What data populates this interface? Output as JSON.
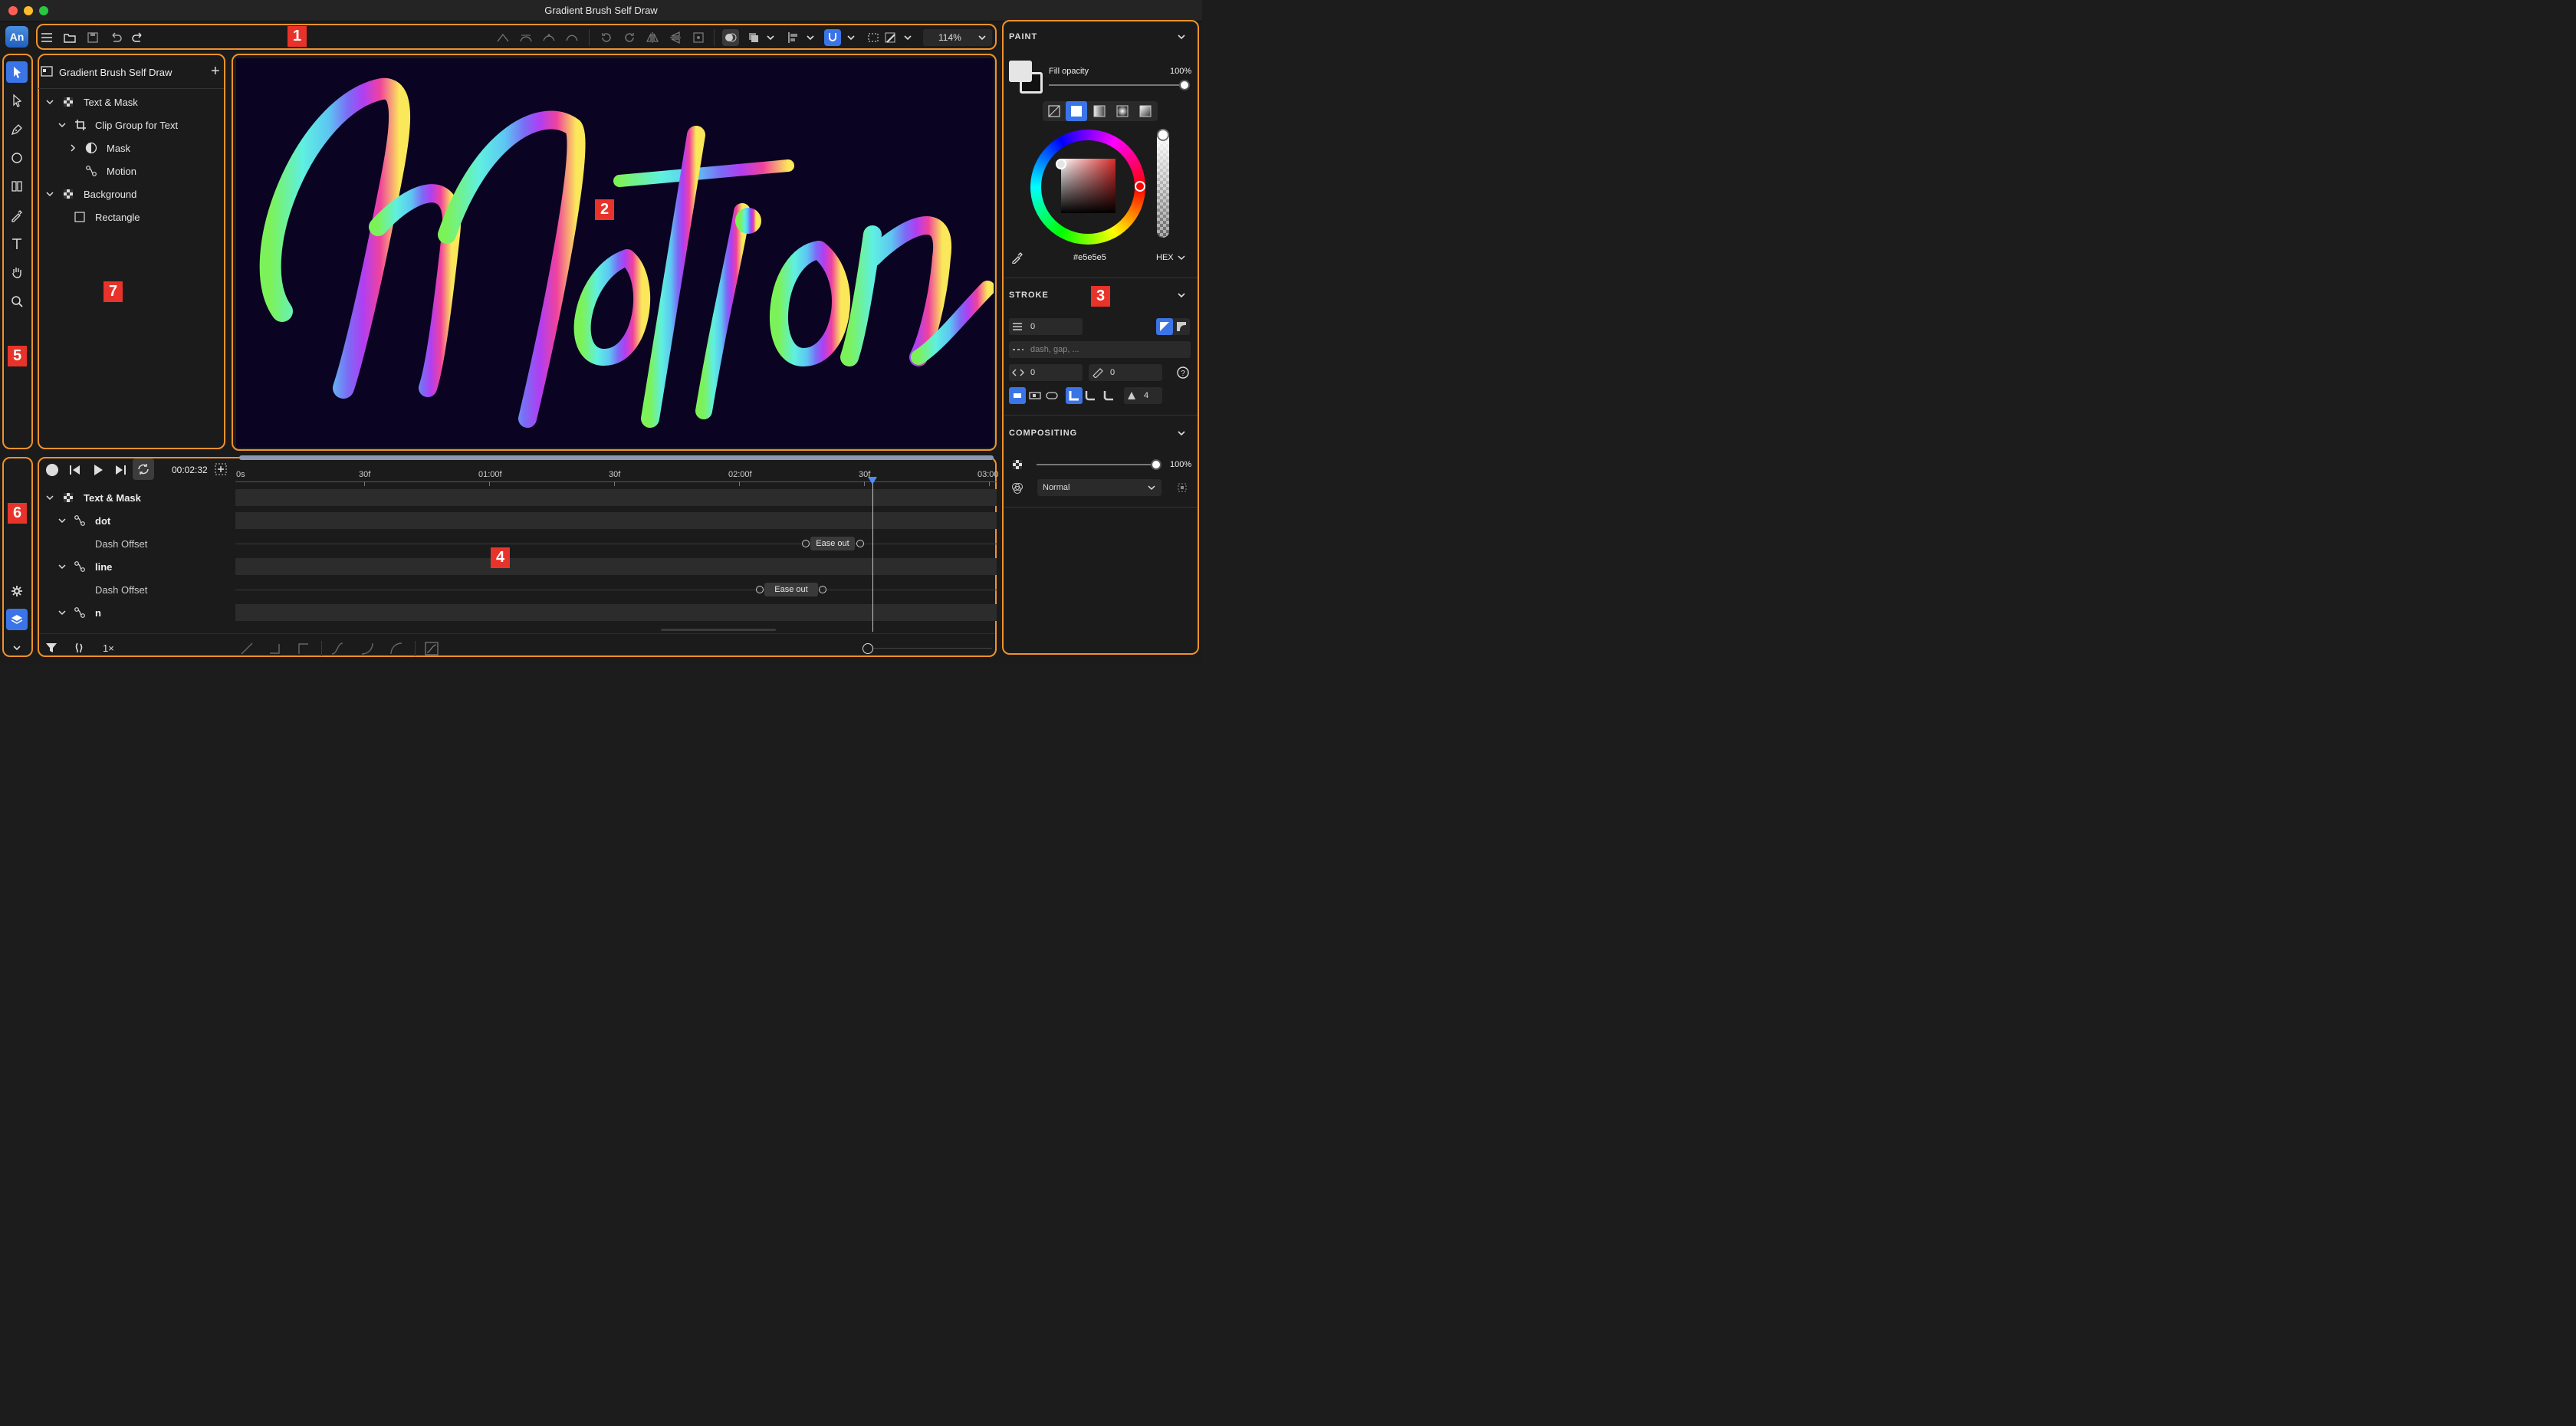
{
  "window": {
    "title": "Gradient Brush Self Draw"
  },
  "app_logo": "An",
  "badges": {
    "b1": "1",
    "b2": "2",
    "b3": "3",
    "b4": "4",
    "b5": "5",
    "b6": "6",
    "b7": "7"
  },
  "toolbar": {
    "zoom": "114%"
  },
  "layers": {
    "title": "Gradient Brush Self Draw",
    "items": [
      {
        "label": "Text & Mask"
      },
      {
        "label": "Clip Group for Text"
      },
      {
        "label": "Mask"
      },
      {
        "label": "Motion"
      },
      {
        "label": "Background"
      },
      {
        "label": "Rectangle"
      }
    ]
  },
  "canvas": {
    "text": "Motion",
    "background": "#0b0322"
  },
  "paint": {
    "title": "PAINT",
    "fill_opacity_label": "Fill opacity",
    "fill_opacity_value": "100%",
    "hex_value": "#e5e5e5",
    "hex_mode": "HEX"
  },
  "stroke": {
    "title": "STROKE",
    "width": "0",
    "dash_placeholder": "dash, gap, ...",
    "offset": "0",
    "miter": "0",
    "corner_value": "4"
  },
  "compositing": {
    "title": "COMPOSITING",
    "opacity": "100%",
    "blend_mode": "Normal"
  },
  "timeline": {
    "time": "00:02:32",
    "ruler": [
      "0s",
      "30f",
      "01:00f",
      "30f",
      "02:00f",
      "30f",
      "03:00"
    ],
    "rows": [
      {
        "label": "Text & Mask"
      },
      {
        "label": "dot"
      },
      {
        "label": "Dash Offset"
      },
      {
        "label": "line"
      },
      {
        "label": "Dash Offset"
      },
      {
        "label": "n"
      }
    ],
    "ease1": "Ease out",
    "ease2": "Ease out",
    "speed": "1×"
  },
  "colors": {
    "accent": "#f0922b",
    "badge": "#e8332a",
    "selected": "#3b74e6"
  }
}
